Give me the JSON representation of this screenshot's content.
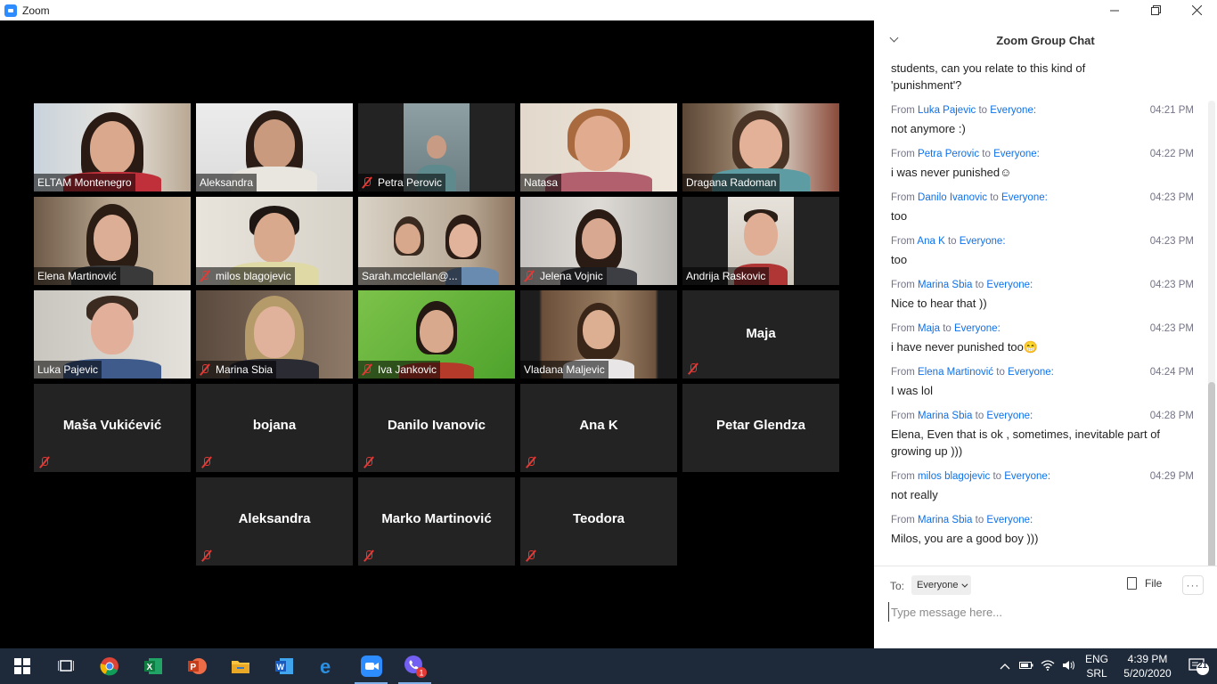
{
  "window": {
    "title": "Zoom"
  },
  "participants": [
    {
      "name": "ELTAM Montenegro",
      "muted": false
    },
    {
      "name": "Aleksandra",
      "muted": false
    },
    {
      "name": "Petra Perovic",
      "muted": true
    },
    {
      "name": "Natasa",
      "muted": false
    },
    {
      "name": "Dragana Radoman",
      "muted": false
    },
    {
      "name": "Elena Martinović",
      "muted": false
    },
    {
      "name": "milos blagojevic",
      "muted": true
    },
    {
      "name": "Sarah.mcclellan@...",
      "muted": false
    },
    {
      "name": "Jelena Vojnic",
      "muted": true
    },
    {
      "name": "Andrija Raskovic",
      "muted": false
    },
    {
      "name": "Luka Pajevic",
      "muted": false
    },
    {
      "name": "Marina Sbia",
      "muted": true
    },
    {
      "name": "Iva Jankovic",
      "muted": true
    },
    {
      "name": "Vladana Maljevic",
      "muted": false
    },
    {
      "name": "Maja",
      "muted": true
    },
    {
      "name": "Maša Vukićević",
      "muted": true
    },
    {
      "name": "bojana",
      "muted": true
    },
    {
      "name": "Danilo Ivanovic",
      "muted": true
    },
    {
      "name": "Ana K",
      "muted": true
    },
    {
      "name": "Petar Glendza",
      "muted": false
    },
    {
      "name": "Aleksandra",
      "muted": true
    },
    {
      "name": "Marko Martinović",
      "muted": true
    },
    {
      "name": "Teodora",
      "muted": true
    }
  ],
  "chat": {
    "title": "Zoom Group Chat",
    "intro_lines": [
      "students, can you relate to this kind of",
      "'punishment'?"
    ],
    "from_word": "From",
    "to_word": "to",
    "messages": [
      {
        "sender": "Luka Pajevic",
        "recipient": "Everyone:",
        "time": "04:21 PM",
        "text": "not anymore :)"
      },
      {
        "sender": "Petra Perovic",
        "recipient": "Everyone:",
        "time": "04:22 PM",
        "text": "i was never punished☺"
      },
      {
        "sender": "Danilo Ivanovic",
        "recipient": "Everyone:",
        "time": "04:23 PM",
        "text": "too"
      },
      {
        "sender": "Ana K",
        "recipient": "Everyone:",
        "time": "04:23 PM",
        "text": "too"
      },
      {
        "sender": "Marina Sbia",
        "recipient": "Everyone:",
        "time": "04:23 PM",
        "text": "Nice to hear that ))"
      },
      {
        "sender": "Maja",
        "recipient": "Everyone:",
        "time": "04:23 PM",
        "text": "i have never punished too😁"
      },
      {
        "sender": "Elena Martinović",
        "recipient": "Everyone:",
        "time": "04:24 PM",
        "text": "I was lol"
      },
      {
        "sender": "Marina Sbia",
        "recipient": "Everyone:",
        "time": "04:28 PM",
        "text": "Elena, Even that is ok , sometimes, inevitable  part of growing up )))"
      },
      {
        "sender": "milos blagojevic",
        "recipient": "Everyone:",
        "time": "04:29 PM",
        "text": "not really"
      },
      {
        "sender": "Marina Sbia",
        "recipient": "Everyone:",
        "time": "",
        "text": "Milos, you are a good boy )))"
      }
    ],
    "to_label": "To:",
    "to_value": "Everyone",
    "file_label": "File",
    "more_label": "···",
    "input_placeholder": "Type message here..."
  },
  "taskbar": {
    "apps": [
      "start-icon",
      "task-view-icon",
      "chrome-icon",
      "excel-icon",
      "powerpoint-icon",
      "file-explorer-icon",
      "word-icon",
      "edge-icon",
      "zoom-icon",
      "viber-icon"
    ],
    "viber_badge": "1",
    "lang_top": "ENG",
    "lang_bottom": "SRL",
    "time": "4:39 PM",
    "date": "5/20/2020",
    "notification_count": "21"
  },
  "colors": {
    "accent": "#0e71eb",
    "active_speaker": "#f3e05a",
    "tile_bg": "#232323",
    "muted": "#e53935"
  }
}
